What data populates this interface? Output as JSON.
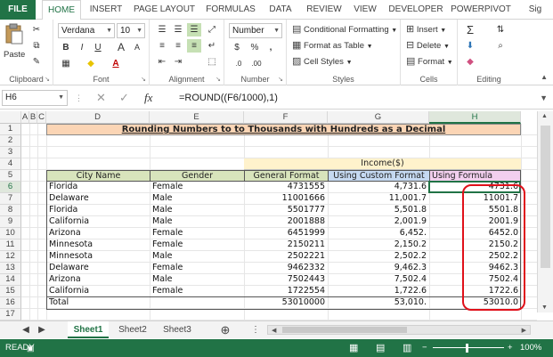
{
  "ribbon_tabs": [
    "FILE",
    "HOME",
    "INSERT",
    "PAGE LAYOUT",
    "FORMULAS",
    "DATA",
    "REVIEW",
    "VIEW",
    "DEVELOPER",
    "POWERPIVOT",
    "Sig"
  ],
  "active_tab": "HOME",
  "clipboard": {
    "paste_label": "Paste",
    "group_label": "Clipboard"
  },
  "font": {
    "name": "Verdana",
    "size": "10",
    "bold": "B",
    "italic": "I",
    "underline": "U",
    "grow": "A",
    "shrink": "A",
    "group_label": "Font"
  },
  "alignment": {
    "group_label": "Alignment"
  },
  "number": {
    "format": "Number",
    "currency": "$",
    "percent": "%",
    "comma": ",",
    "group_label": "Number"
  },
  "styles": {
    "conditional": "Conditional Formatting",
    "table": "Format as Table",
    "cell_styles": "Cell Styles",
    "group_label": "Styles"
  },
  "cells": {
    "insert": "Insert",
    "delete": "Delete",
    "format": "Format",
    "group_label": "Cells"
  },
  "editing": {
    "group_label": "Editing"
  },
  "formula_bar": {
    "name_box": "H6",
    "fx": "fx",
    "formula": "=ROUND((F6/1000),1)"
  },
  "columns": [
    "A",
    "B",
    "C",
    "D",
    "E",
    "F",
    "G",
    "H"
  ],
  "rows": [
    "1",
    "2",
    "3",
    "4",
    "5",
    "6",
    "7",
    "8",
    "9",
    "10",
    "11",
    "12",
    "13",
    "14",
    "15",
    "16",
    "17"
  ],
  "sheet": {
    "title": "Rounding Numbers to to Thousands with Hundreds as a Decimal",
    "income_header": "Income($)",
    "headers": {
      "city": "City Name",
      "gender": "Gender",
      "general": "General Format",
      "custom": "Using Custom Format",
      "formula": "Using Formula"
    },
    "data_rows": [
      {
        "city": "Florida",
        "gender": "Female",
        "general": "4731555",
        "custom": "4,731.6",
        "formula": "4731.6"
      },
      {
        "city": "Delaware",
        "gender": "Male",
        "general": "11001666",
        "custom": "11,001.7",
        "formula": "11001.7"
      },
      {
        "city": "Florida",
        "gender": "Male",
        "general": "5501777",
        "custom": "5,501.8",
        "formula": "5501.8"
      },
      {
        "city": "California",
        "gender": "Male",
        "general": "2001888",
        "custom": "2,001.9",
        "formula": "2001.9"
      },
      {
        "city": "Arizona",
        "gender": "Female",
        "general": "6451999",
        "custom": "6,452.",
        "formula": "6452.0"
      },
      {
        "city": "Minnesota",
        "gender": "Female",
        "general": "2150211",
        "custom": "2,150.2",
        "formula": "2150.2"
      },
      {
        "city": "Minnesota",
        "gender": "Male",
        "general": "2502221",
        "custom": "2,502.2",
        "formula": "2502.2"
      },
      {
        "city": "Delaware",
        "gender": "Female",
        "general": "9462332",
        "custom": "9,462.3",
        "formula": "9462.3"
      },
      {
        "city": "Arizona",
        "gender": "Male",
        "general": "7502443",
        "custom": "7,502.4",
        "formula": "7502.4"
      },
      {
        "city": "California",
        "gender": "Female",
        "general": "1722554",
        "custom": "1,722.6",
        "formula": "1722.6"
      }
    ],
    "total": {
      "label": "Total",
      "general": "53010000",
      "custom": "53,010.",
      "formula": "53010.0"
    }
  },
  "sheet_tabs": [
    "Sheet1",
    "Sheet2",
    "Sheet3"
  ],
  "status": {
    "ready": "READY",
    "zoom": "100%"
  },
  "colors": {
    "accent": "#217346",
    "title_fill": "#fbd5b5",
    "header_green": "#d8e4bc",
    "custom_blue": "#c5d9f1",
    "formula_pink": "#f2cfee",
    "income_yellow": "#fff2cc",
    "highlight_red": "#e0101a"
  }
}
